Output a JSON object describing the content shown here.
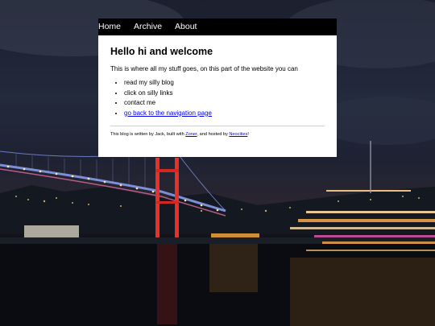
{
  "nav": {
    "items": [
      "Home",
      "Archive",
      "About"
    ]
  },
  "main": {
    "heading": "Hello hi and welcome",
    "intro": "This is where all my stuff goes, on this part of the website you can",
    "list_items": [
      "read my silly blog",
      "click on silly links",
      "contact me",
      "go back to the navigation page"
    ]
  },
  "footer": {
    "text_1": "This blog is written by Jack, built with ",
    "link_zoner": "Zoner",
    "text_2": ", and hosted by ",
    "link_neocities": "Neocities",
    "text_3": "!"
  },
  "colors": {
    "nav_bg": "#000000",
    "link": "#0000ee",
    "page_bg": "#ffffff"
  }
}
